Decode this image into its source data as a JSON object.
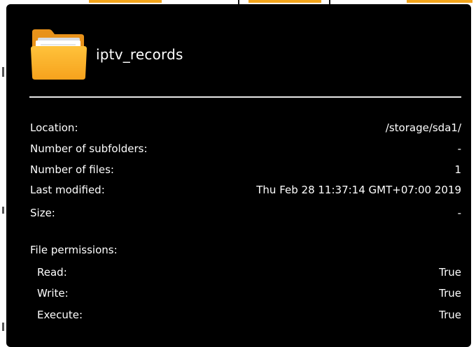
{
  "folder": {
    "icon": "folder-icon",
    "name": "iptv_records"
  },
  "details": [
    {
      "label": "Location:",
      "value": "/storage/sda1/"
    },
    {
      "label": "Number of subfolders:",
      "value": "-"
    },
    {
      "label": "Number of files:",
      "value": "1"
    },
    {
      "label": "Last modified:",
      "value": "Thu Feb 28 11:37:14 GMT+07:00 2019"
    },
    {
      "label": "Size:",
      "value": "-"
    }
  ],
  "permissions": {
    "heading": "File permissions:",
    "items": [
      {
        "label": "Read:",
        "value": "True"
      },
      {
        "label": "Write:",
        "value": "True"
      },
      {
        "label": "Execute:",
        "value": "True"
      }
    ]
  },
  "colors": {
    "dialog_bg": "#000000",
    "text": "#ffffff",
    "folder_accent": "#f7a825",
    "top_tabs": "#f2a51c"
  }
}
